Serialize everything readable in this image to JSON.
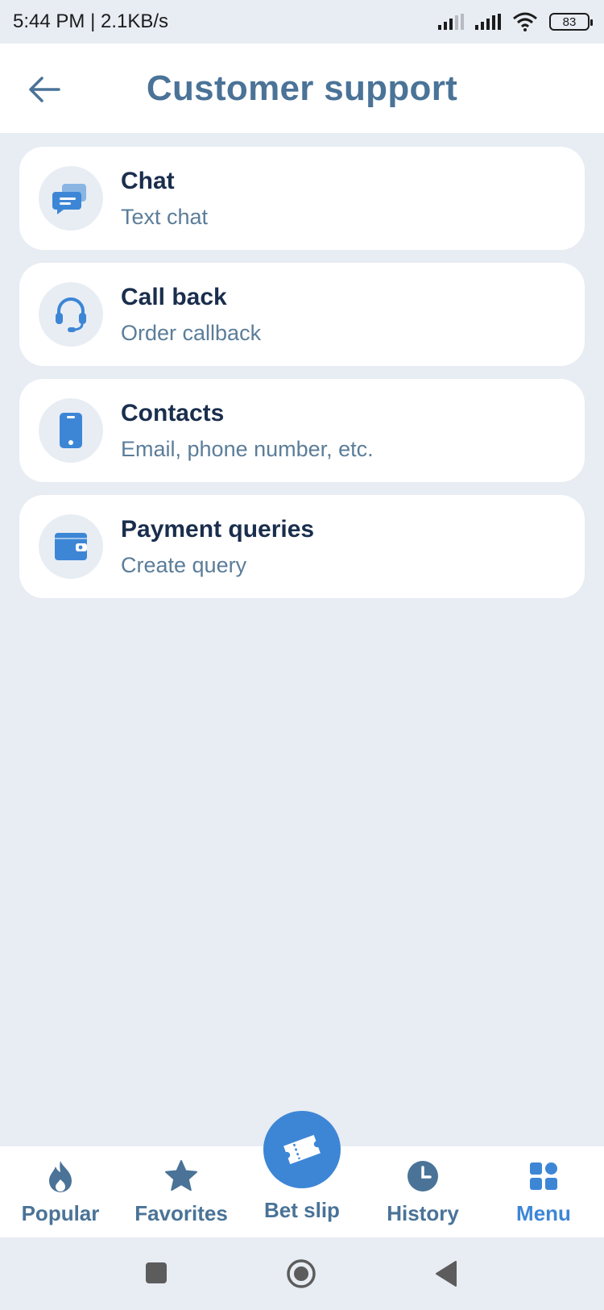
{
  "status_bar": {
    "time": "5:44 PM",
    "separator": "|",
    "speed": "2.1KB/s",
    "battery": "83"
  },
  "header": {
    "title": "Customer support",
    "back_icon": "arrow-left-icon"
  },
  "support_options": [
    {
      "title": "Chat",
      "subtitle": "Text chat",
      "icon": "chat-icon"
    },
    {
      "title": "Call back",
      "subtitle": "Order callback",
      "icon": "headset-icon"
    },
    {
      "title": "Contacts",
      "subtitle": "Email, phone number, etc.",
      "icon": "phone-icon"
    },
    {
      "title": "Payment queries",
      "subtitle": "Create query",
      "icon": "wallet-icon"
    }
  ],
  "bottom_nav": {
    "items": [
      {
        "label": "Popular",
        "icon": "flame-icon"
      },
      {
        "label": "Favorites",
        "icon": "star-icon"
      },
      {
        "label": "Bet slip",
        "icon": "ticket-icon"
      },
      {
        "label": "History",
        "icon": "clock-icon"
      },
      {
        "label": "Menu",
        "icon": "grid-icon",
        "active": true
      }
    ]
  },
  "colors": {
    "accent": "#3d86d6",
    "title": "#4a7397",
    "background": "#e8ecf3"
  }
}
